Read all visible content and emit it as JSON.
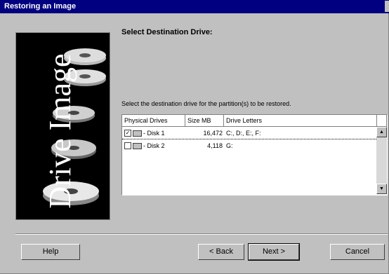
{
  "window": {
    "title": "Restoring an Image"
  },
  "banner": {
    "text": "Drive Image"
  },
  "page": {
    "heading": "Select Destination Drive:",
    "instruction": "Select the destination drive for the partition(s) to be restored."
  },
  "table": {
    "columns": [
      "Physical Drives",
      "Size MB",
      "Drive Letters"
    ],
    "rows": [
      {
        "checked": true,
        "drive": "- Disk 1",
        "size": "16,472",
        "letters": "C:, D:, E:, F:"
      },
      {
        "checked": false,
        "drive": "- Disk 2",
        "size": "4,118",
        "letters": "G:"
      }
    ]
  },
  "buttons": {
    "help": "Help",
    "back": "< Back",
    "next": "Next >",
    "cancel": "Cancel"
  },
  "icons": {
    "drive": "hard-drive-icon",
    "checkbox": "checkbox-icon"
  }
}
